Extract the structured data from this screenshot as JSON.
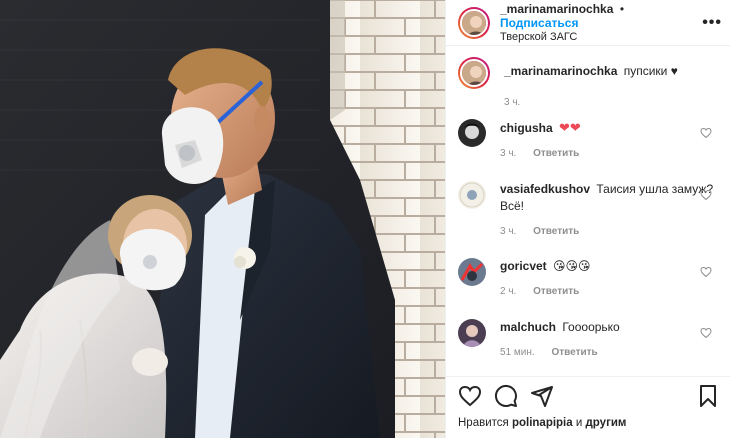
{
  "post": {
    "author": "_marinamarinochka",
    "separator": "•",
    "follow_label": "Подписаться",
    "location": "Тверской ЗАГС",
    "more_label": "•••"
  },
  "caption": {
    "username": "_marinamarinochka",
    "text": "пупсики ♥",
    "time": "3 ч."
  },
  "comments": [
    {
      "username": "chigusha",
      "text": "",
      "emoji": "❤❤",
      "time": "3 ч.",
      "reply": "Ответить"
    },
    {
      "username": "vasiafedkushov",
      "text": "Таисия ушла замуж? Всё!",
      "emoji": "",
      "time": "3 ч.",
      "reply": "Ответить"
    },
    {
      "username": "goricvet",
      "text": "",
      "emoji": "😘😘😘",
      "time": "2 ч.",
      "reply": "Ответить"
    },
    {
      "username": "malchuch",
      "text": "Гоооорько",
      "emoji": "",
      "time": "51 мин.",
      "reply": "Ответить"
    }
  ],
  "likes": {
    "prefix": "Нравится",
    "user1": "polinapipia",
    "middle": "и",
    "user2": "другим"
  },
  "colors": {
    "follow": "#0095f6",
    "heart": "#ed4956",
    "muted": "#8e8e8e",
    "text": "#262626"
  },
  "icons": [
    "heart-icon",
    "comment-icon",
    "share-icon",
    "bookmark-icon",
    "more-icon"
  ]
}
